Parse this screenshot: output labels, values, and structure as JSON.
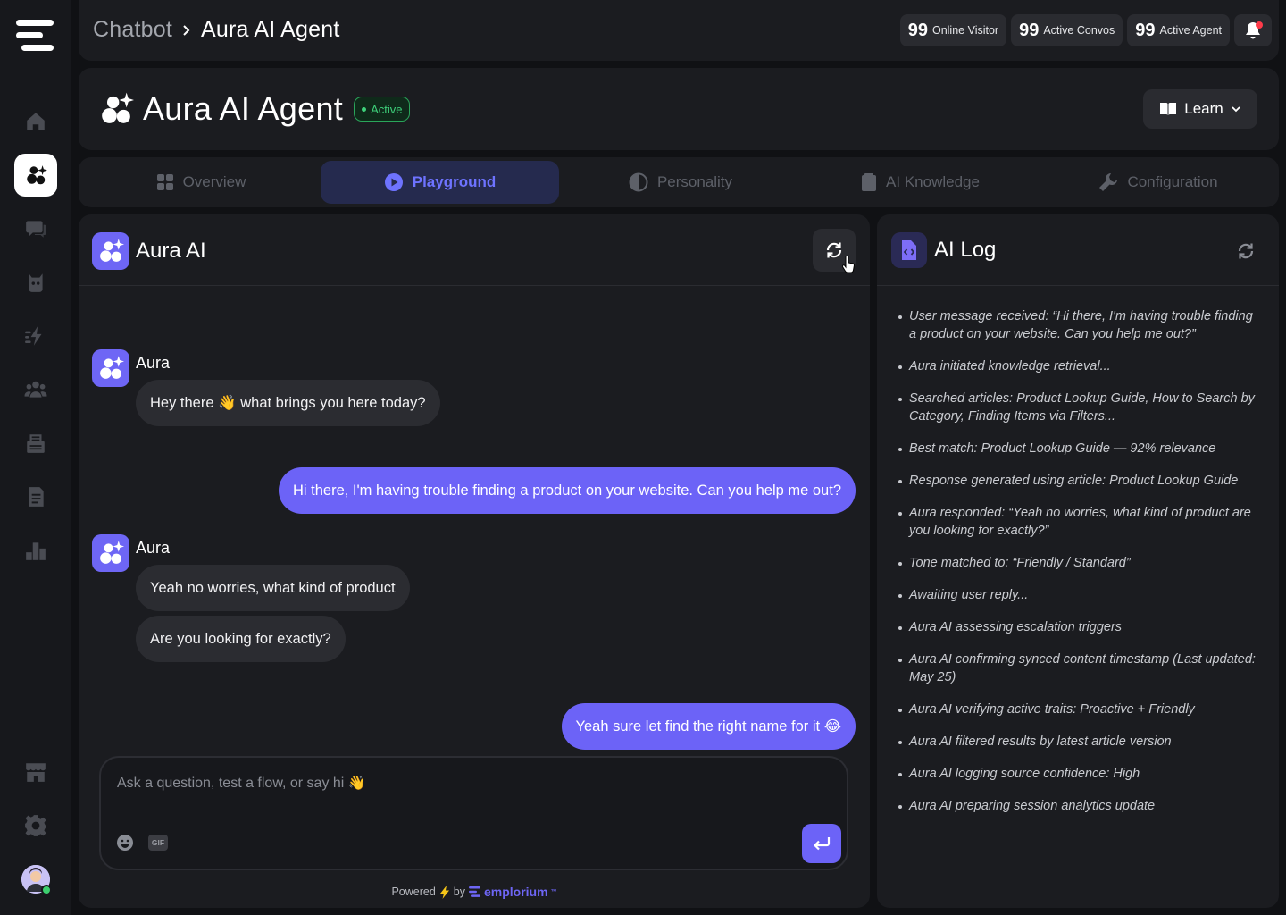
{
  "breadcrumb": {
    "parent": "Chatbot",
    "current": "Aura AI Agent"
  },
  "stats": [
    {
      "value": "99",
      "label": "Online Visitor"
    },
    {
      "value": "99",
      "label": "Active Convos"
    },
    {
      "value": "99",
      "label": "Active Agent"
    }
  ],
  "header": {
    "title": "Aura AI Agent",
    "status": "Active",
    "learn_label": "Learn"
  },
  "tabs": [
    "Overview",
    "Playground",
    "Personality",
    "AI Knowledge",
    "Configuration"
  ],
  "active_tab": "Playground",
  "chat": {
    "title": "Aura AI",
    "messages": [
      {
        "from": "bot",
        "sender": "Aura",
        "lines": [
          "Hey there 👋 what brings you here today?"
        ]
      },
      {
        "from": "user",
        "lines": [
          "Hi there, I'm having trouble finding a product on your website. Can you help me out?"
        ]
      },
      {
        "from": "bot",
        "sender": "Aura",
        "lines": [
          "Yeah no worries, what kind of product",
          "Are you looking for exactly?"
        ]
      },
      {
        "from": "user",
        "lines": [
          "Yeah sure let find the right name for it 😂"
        ]
      }
    ],
    "composer_placeholder": "Ask a question, test a flow, or say hi 👋",
    "gif_label": "GIF",
    "powered_by": "Powered",
    "by": "by",
    "brand": "emplorium",
    "brand_tm": "™"
  },
  "log": {
    "title": "AI Log",
    "entries": [
      "User message received: “Hi there, I'm having trouble finding a product on your website. Can you help me out?”",
      "Aura initiated knowledge retrieval...",
      "Searched articles: Product Lookup Guide, How to Search by Category, Finding Items via Filters...",
      "Best match: Product Lookup Guide — 92% relevance",
      "Response generated using article: Product Lookup Guide",
      "Aura responded: “Yeah no worries, what kind of product are you looking for exactly?”",
      "Tone matched to: “Friendly / Standard”",
      "Awaiting user reply...",
      "Aura AI assessing escalation triggers",
      "Aura AI confirming synced content timestamp (Last updated: May 25)",
      "Aura AI verifying active traits: Proactive + Friendly",
      "Aura AI filtered results by latest article version",
      "Aura AI logging source confidence: High",
      "Aura AI preparing session analytics update"
    ]
  },
  "sidebar_icons": [
    "home-icon",
    "ai-agent-icon",
    "chat-icon",
    "bot-icon",
    "automation-icon",
    "team-icon",
    "inbox-icon",
    "document-icon",
    "analytics-icon",
    "store-icon",
    "settings-icon"
  ],
  "colors": {
    "accent": "#6c63f7",
    "background": "#101114",
    "panel": "#1b1c20",
    "active_green": "#3ed07a"
  }
}
